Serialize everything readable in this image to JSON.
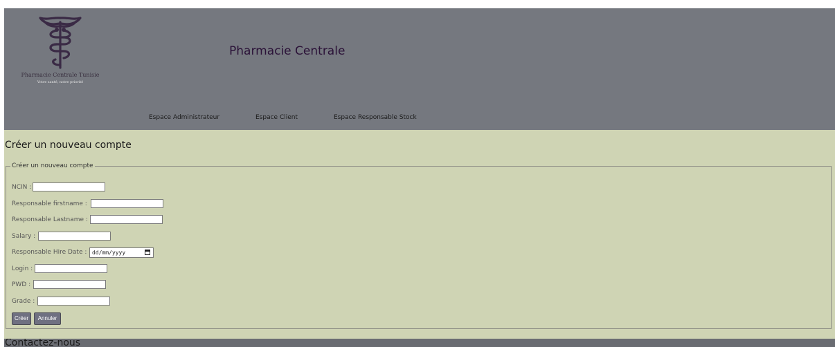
{
  "header": {
    "title": "Pharmacie Centrale",
    "logo": {
      "icon": "caduceus-icon",
      "name": "Pharmacie Centrale Tunisie",
      "tagline": "Votre santé, notre priorité"
    },
    "nav": [
      {
        "label": "Espace Administrateur"
      },
      {
        "label": "Espace Client"
      },
      {
        "label": "Espace Responsable Stock"
      }
    ]
  },
  "main": {
    "heading": "Créer un nouveau compte",
    "form": {
      "legend": "Créer un nouveau compte",
      "fields": {
        "ncin": {
          "label": "NCIN :",
          "value": ""
        },
        "firstname": {
          "label": "Responsable firstname :",
          "value": ""
        },
        "lastname": {
          "label": "Responsable Lastname :",
          "value": ""
        },
        "salary": {
          "label": "Salary :",
          "value": ""
        },
        "hire_date": {
          "label": "Responsable Hire Date :",
          "placeholder": "dd/mm/yyyy"
        },
        "login": {
          "label": "Login :",
          "value": ""
        },
        "pwd": {
          "label": "PWD :",
          "value": ""
        },
        "grade": {
          "label": "Grade :",
          "value": ""
        }
      },
      "submit_label": "Créer",
      "cancel_label": "Annuler"
    }
  },
  "footer": {
    "heading": "Contactez-nous"
  },
  "colors": {
    "header_bg": "#75787f",
    "content_bg": "#cfd4b4",
    "title_color": "#2b1238",
    "button_bg": "#6f7081"
  }
}
